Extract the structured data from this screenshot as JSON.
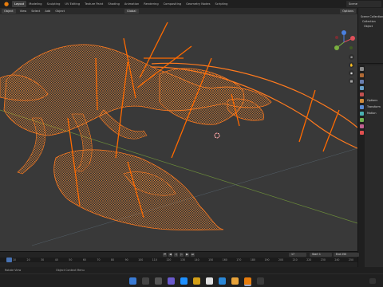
{
  "menubar": {
    "tabs": [
      "Layout",
      "Modeling",
      "Sculpting",
      "UV Editing",
      "Texture Paint",
      "Shading",
      "Animation",
      "Rendering",
      "Compositing",
      "Geometry Nodes",
      "Scripting"
    ],
    "active_tab": 0,
    "scene_label": "Scene"
  },
  "header": {
    "mode": "Object",
    "view": "View",
    "select": "Select",
    "add": "Add",
    "object": "Object",
    "orientation": "Global",
    "options": "Options"
  },
  "outliner": {
    "rows": [
      "Scene Collection",
      "Collection",
      "Object"
    ]
  },
  "properties": {
    "rows": [
      "Options",
      "Transform",
      "Motion"
    ]
  },
  "timeline": {
    "current_frame": "17",
    "start_label": "Start",
    "start_value": "1",
    "end_label": "End",
    "end_value": "250",
    "ticks": [
      "10",
      "20",
      "30",
      "40",
      "50",
      "60",
      "70",
      "80",
      "90",
      "100",
      "110",
      "120",
      "130",
      "140",
      "150",
      "160",
      "170",
      "180",
      "190",
      "200",
      "210",
      "220",
      "230",
      "240",
      "250"
    ]
  },
  "statusbar": {
    "left": "Rotate View",
    "middle": "Object Context Menu"
  },
  "taskbar": {
    "time": "12:00"
  },
  "colors": {
    "accent": "#e87d0d",
    "wire": "#ff7a1e",
    "viewport_bg": "#3a3a3a"
  }
}
